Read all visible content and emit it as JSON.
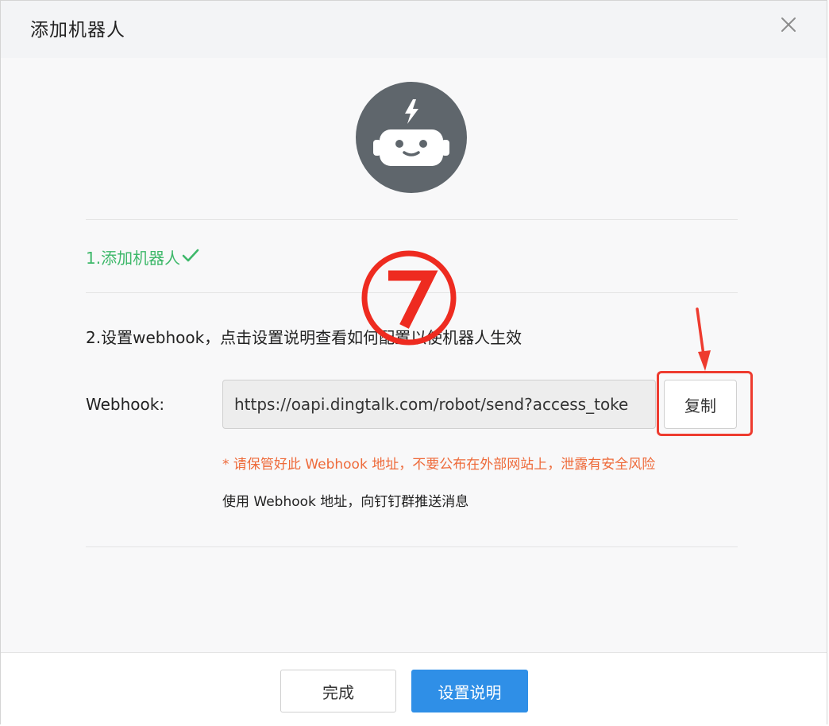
{
  "dialog": {
    "title": "添加机器人",
    "close_icon": "close-icon"
  },
  "content": {
    "avatar_icon": "robot-icon",
    "step1": {
      "label": "1.添加机器人",
      "status_icon": "checkmark-icon"
    },
    "step2": {
      "label": "2.设置webhook，点击设置说明查看如何配置以使机器人生效"
    },
    "webhook": {
      "label": "Webhook:",
      "value": "https://oapi.dingtalk.com/robot/send?access_toke",
      "copy_label": "复制"
    },
    "warning": "* 请保管好此 Webhook 地址，不要公布在外部网站上，泄露有安全风险",
    "usage": "使用 Webhook 地址，向钉钉群推送消息"
  },
  "annotations": {
    "step_marker": "⑦",
    "highlight_color": "#ee3b2f"
  },
  "footer": {
    "done_label": "完成",
    "help_label": "设置说明"
  },
  "colors": {
    "success": "#3eb86a",
    "warning": "#ee6a3a",
    "primary": "#2f8fe7",
    "avatar_bg": "#5f666c"
  }
}
